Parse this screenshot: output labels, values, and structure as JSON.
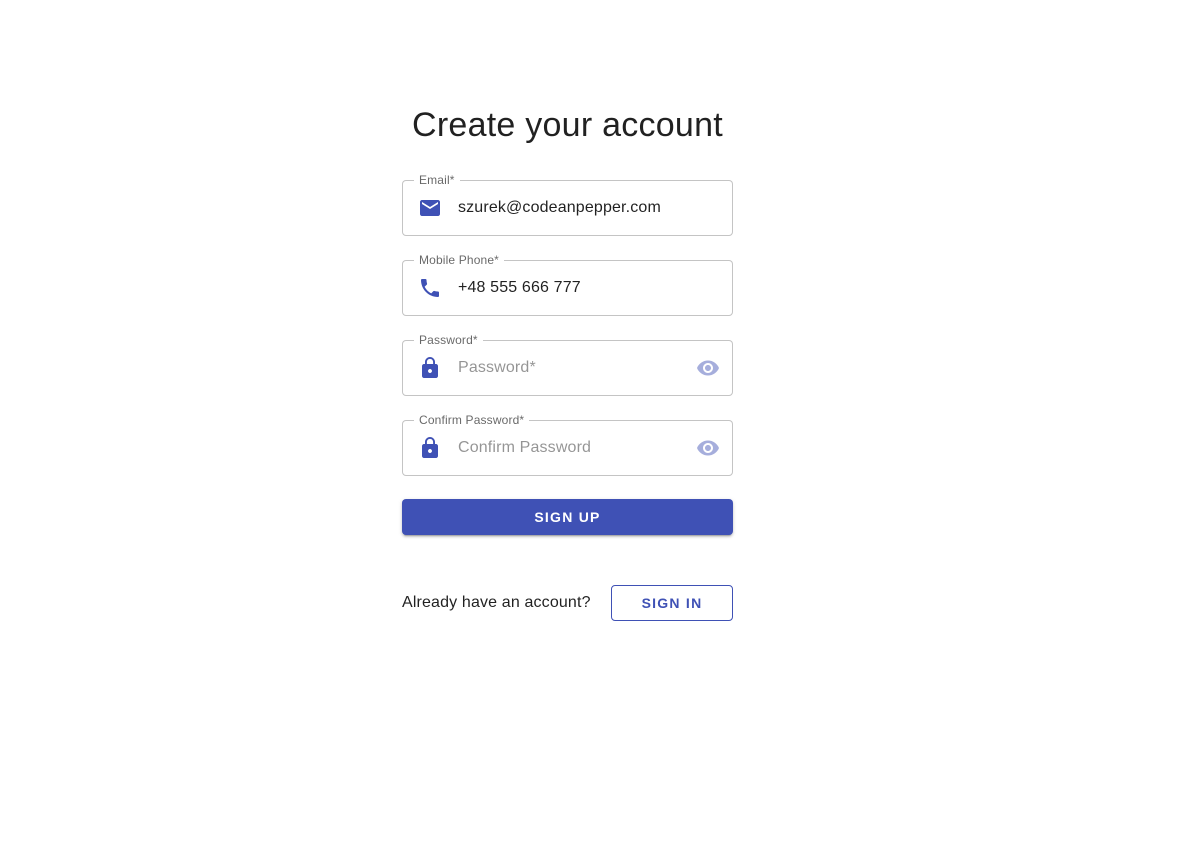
{
  "title": "Create your account",
  "colors": {
    "primary": "#3f51b5",
    "eye_icon": "#a6aedc"
  },
  "form": {
    "email": {
      "label": "Email*",
      "value": "szurek@codeanpepper.com",
      "icon": "mail-icon"
    },
    "phone": {
      "label": "Mobile Phone*",
      "value": "+48 555 666 777",
      "icon": "phone-icon"
    },
    "password": {
      "label": "Password*",
      "placeholder": "Password*",
      "value": "",
      "icon": "lock-icon",
      "toggle_icon": "eye-icon"
    },
    "confirm_password": {
      "label": "Confirm Password*",
      "placeholder": "Confirm Password",
      "value": "",
      "icon": "lock-icon",
      "toggle_icon": "eye-icon"
    },
    "submit_label": "SIGN UP"
  },
  "footer": {
    "prompt": "Already have an account?",
    "signin_label": "SIGN IN"
  }
}
